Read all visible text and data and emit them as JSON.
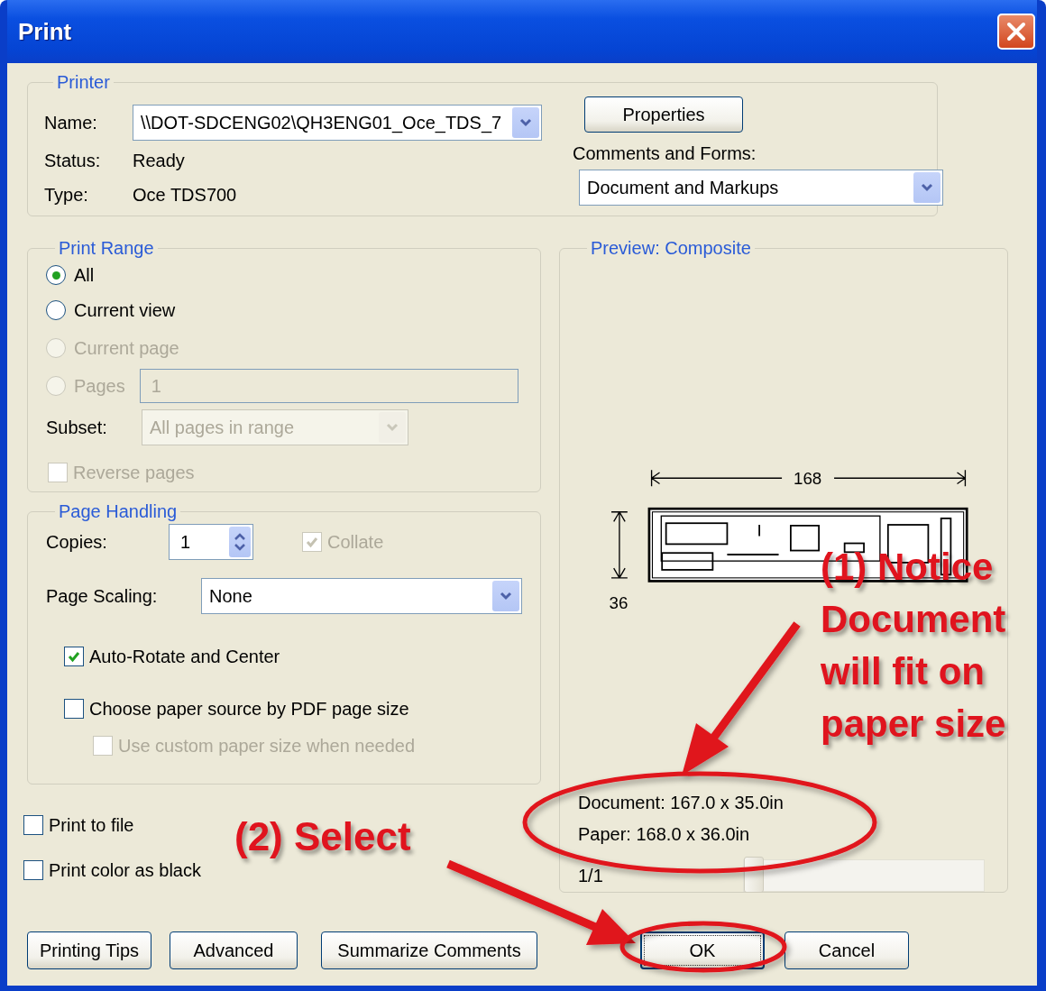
{
  "window": {
    "title": "Print"
  },
  "printer": {
    "title": "Printer",
    "name_label": "Name:",
    "name_value": "\\\\DOT-SDCENG02\\QH3ENG01_Oce_TDS_7",
    "status_label": "Status:",
    "status_value": "Ready",
    "type_label": "Type:",
    "type_value": "Oce TDS700",
    "properties_button": "Properties",
    "comments_label": "Comments and Forms:",
    "comments_value": "Document and Markups"
  },
  "print_range": {
    "title": "Print Range",
    "options": [
      {
        "label": "All",
        "selected": true,
        "disabled": false
      },
      {
        "label": "Current view",
        "selected": false,
        "disabled": false
      },
      {
        "label": "Current page",
        "selected": false,
        "disabled": true
      },
      {
        "label": "Pages",
        "selected": false,
        "disabled": true
      }
    ],
    "pages_value": "1",
    "subset_label": "Subset:",
    "subset_value": "All pages in range",
    "reverse": {
      "label": "Reverse pages",
      "checked": false,
      "disabled": true
    }
  },
  "page_handling": {
    "title": "Page Handling",
    "copies_label": "Copies:",
    "copies_value": "1",
    "collate": {
      "label": "Collate",
      "checked": true,
      "disabled": true
    },
    "scaling_label": "Page Scaling:",
    "scaling_value": "None",
    "options": [
      {
        "label": "Auto-Rotate and Center",
        "checked": true,
        "disabled": false,
        "indented": false
      },
      {
        "label": "Choose paper source by PDF page size",
        "checked": false,
        "disabled": false,
        "indented": false
      },
      {
        "label": "Use custom paper size when needed",
        "checked": false,
        "disabled": true,
        "indented": true
      }
    ]
  },
  "output_options": [
    {
      "label": "Print to file",
      "checked": false
    },
    {
      "label": "Print color as black",
      "checked": false
    }
  ],
  "preview": {
    "title": "Preview: Composite",
    "width_label": "168",
    "height_label": "36",
    "document_size": "Document: 167.0 x 35.0in",
    "paper_size": "Paper: 168.0 x 36.0in",
    "page_indicator": "1/1",
    "level": 0
  },
  "footer_buttons_left": [
    {
      "label": "Printing Tips",
      "focused": false
    },
    {
      "label": "Advanced",
      "focused": false
    },
    {
      "label": "Summarize Comments",
      "focused": false
    }
  ],
  "footer_buttons_right": [
    {
      "label": "OK",
      "focused": true
    },
    {
      "label": "Cancel",
      "focused": false
    }
  ],
  "annotations": [
    {
      "text": "(1) Notice\nDocument\nwill fit on\npaper size"
    },
    {
      "text": "(2) Select"
    }
  ]
}
